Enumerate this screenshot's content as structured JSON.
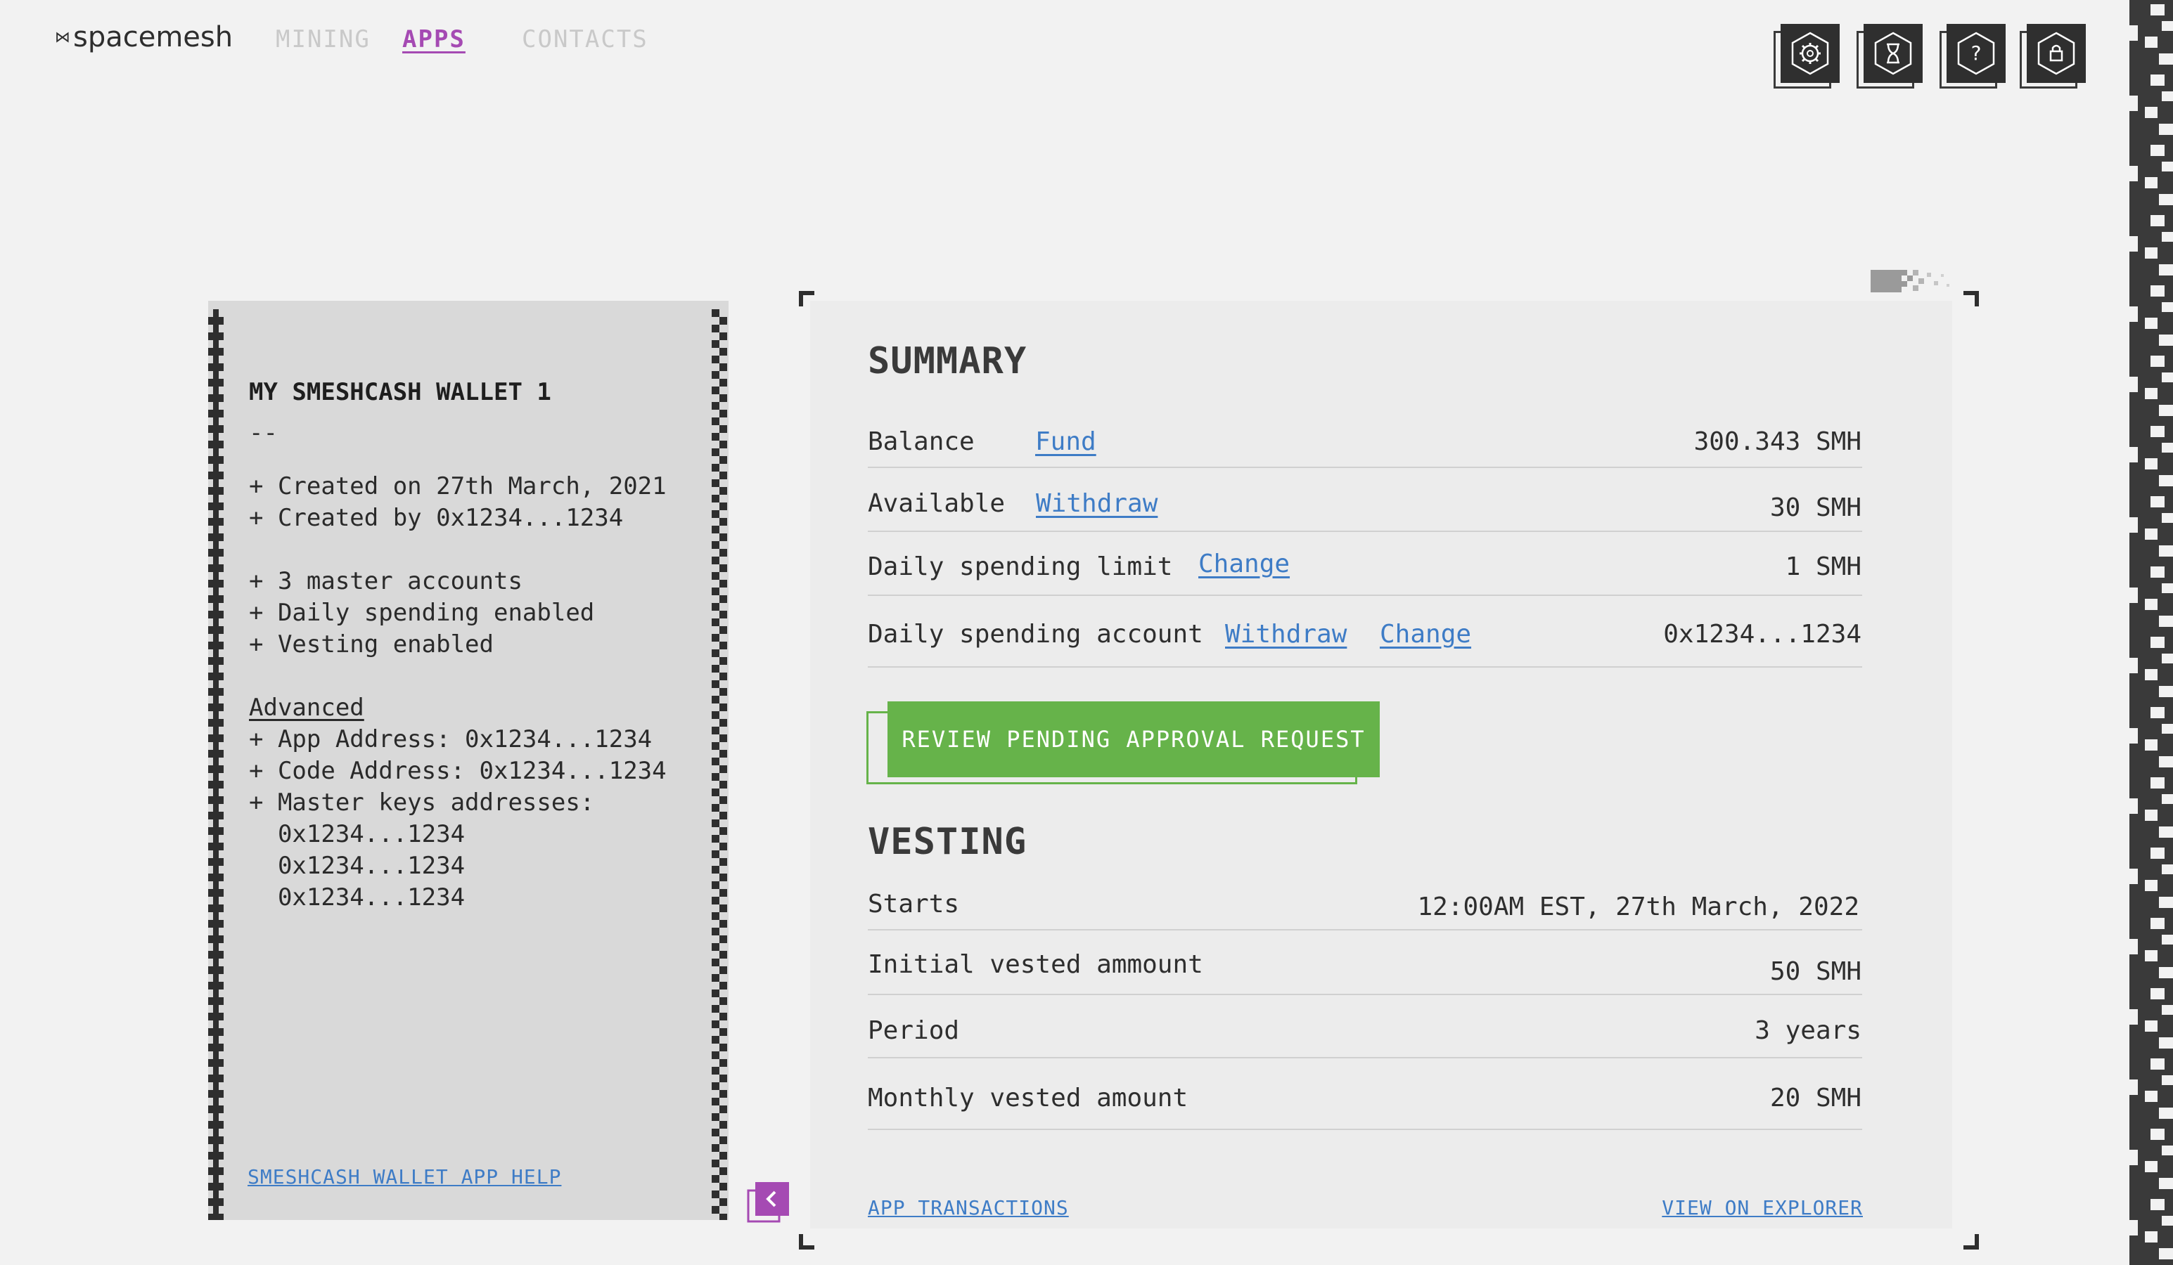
{
  "app": {
    "logo_text": "spacemesh"
  },
  "nav": {
    "items": [
      {
        "label": "MINING"
      },
      {
        "label": "APPS"
      },
      {
        "label": "CONTACTS"
      }
    ],
    "active": "APPS"
  },
  "toolbar": {
    "icons": [
      "settings-icon",
      "hourglass-icon",
      "help-icon",
      "lock-icon"
    ]
  },
  "wallet": {
    "title": "MY SMESHCASH WALLET 1",
    "separator": "--",
    "info": [
      "+ Created on 27th March, 2021",
      "+ Created by 0x1234...1234",
      "+ 3 master accounts",
      "+ Daily spending enabled",
      "+ Vesting enabled"
    ],
    "advanced_label": "Advanced",
    "advanced": [
      "+ App Address: 0x1234...1234",
      "+ Code Address: 0x1234...1234",
      "+ Master keys addresses:",
      "  0x1234...1234",
      "  0x1234...1234",
      "  0x1234...1234"
    ],
    "help_link": "SMESHCASH WALLET APP HELP"
  },
  "summary": {
    "title": "SUMMARY",
    "rows": [
      {
        "label": "Balance",
        "links": [
          "Fund"
        ],
        "value": "300.343 SMH"
      },
      {
        "label": "Available",
        "links": [
          "Withdraw"
        ],
        "value": "30 SMH"
      },
      {
        "label": "Daily spending limit",
        "links": [
          "Change"
        ],
        "value": "1 SMH"
      },
      {
        "label": "Daily spending account",
        "links": [
          "Withdraw",
          "Change"
        ],
        "value": "0x1234...1234"
      }
    ],
    "review_button": "REVIEW PENDING APPROVAL REQUEST"
  },
  "vesting": {
    "title": "VESTING",
    "rows": [
      {
        "label": "Starts",
        "value": "12:00AM EST, 27th March, 2022"
      },
      {
        "label": "Initial vested ammount",
        "value": "50 SMH"
      },
      {
        "label": "Period",
        "value": "3 years"
      },
      {
        "label": "Monthly vested amount",
        "value": "20 SMH"
      }
    ]
  },
  "footer": {
    "transactions_link": "APP TRANSACTIONS",
    "explorer_link": "VIEW ON EXPLORER"
  },
  "colors": {
    "accent": "#a54ab3",
    "link": "#3e7cc6",
    "success": "#66b34a",
    "dark": "#2f2f2f"
  }
}
